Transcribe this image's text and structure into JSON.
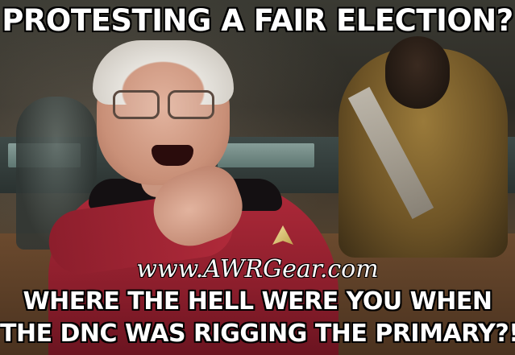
{
  "meme": {
    "top_text": "PROTESTING A FAIR ELECTION?",
    "watermark": "www.AWRGear.com",
    "bottom_text_line1": "WHERE THE HELL WERE YOU WHEN",
    "bottom_text_line2": "THE DNC WAS RIGGING THE PRIMARY?!"
  },
  "colors": {
    "uniform_red": "#b02a3a",
    "uniform_gold": "#9a7a3a",
    "text": "#ffffff",
    "text_outline": "#000000"
  }
}
